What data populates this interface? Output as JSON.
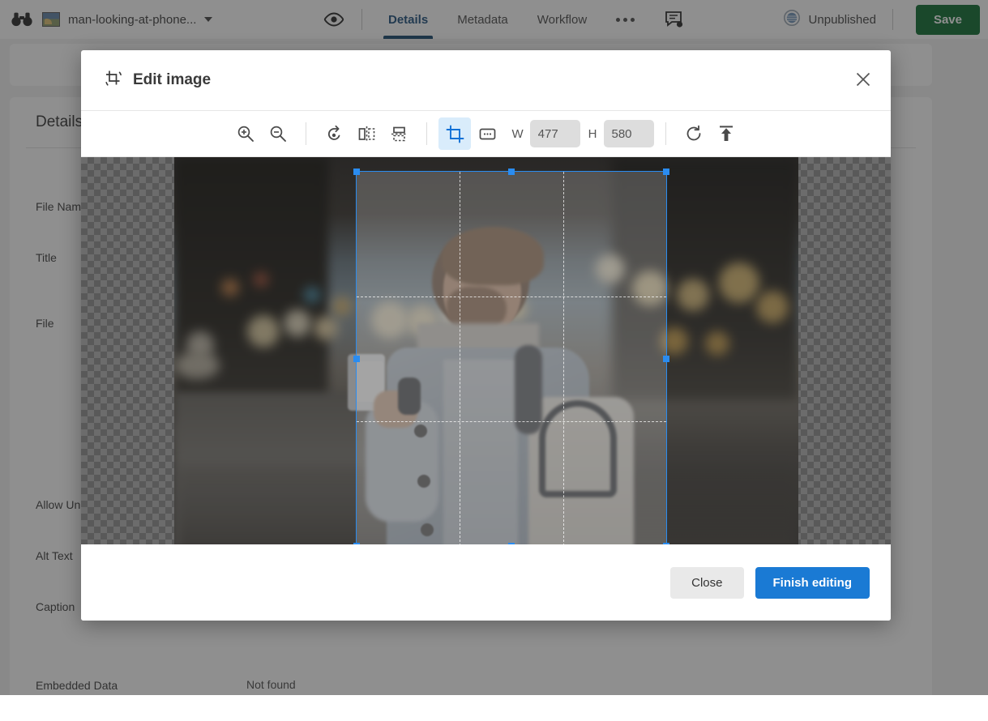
{
  "topbar": {
    "logo_icon": "binoculars-icon",
    "asset_thumb_icon": "image-thumbnail-icon",
    "asset_title": "man-looking-at-phone...",
    "dropdown_icon": "chevron-down-icon",
    "preview_icon": "eye-icon",
    "tabs": [
      {
        "label": "Details",
        "active": true
      },
      {
        "label": "Metadata",
        "active": false
      },
      {
        "label": "Workflow",
        "active": false
      }
    ],
    "overflow_icon": "ellipsis-icon",
    "comments_icon": "comment-settings-icon",
    "publish_status_icon": "globe-icon",
    "publish_status": "Unpublished",
    "save_label": "Save",
    "save_color": "#0b6b2e"
  },
  "background_panel": {
    "heading": "Details",
    "fields": [
      {
        "label": "File Name",
        "value": ""
      },
      {
        "label": "Title",
        "value": ""
      },
      {
        "label": "File",
        "value": ""
      },
      {
        "label": "Allow Unre",
        "value": ""
      },
      {
        "label": "Alt Text",
        "value": ""
      },
      {
        "label": "Caption",
        "value": ""
      },
      {
        "label": "Embedded Data",
        "value": "Not found"
      }
    ]
  },
  "modal": {
    "title": "Edit image",
    "title_icon": "crop-rotate-icon",
    "close_icon": "close-icon",
    "toolbar": {
      "tools": [
        {
          "name": "zoom-in-icon",
          "label": "Zoom in",
          "active": false
        },
        {
          "name": "zoom-out-icon",
          "label": "Zoom out",
          "active": false
        },
        {
          "name": "rotate-left-icon",
          "label": "Rotate left",
          "active": false
        },
        {
          "name": "flip-horizontal-icon",
          "label": "Flip horizontal",
          "active": false
        },
        {
          "name": "flip-vertical-icon",
          "label": "Flip vertical",
          "active": false
        },
        {
          "name": "crop-icon",
          "label": "Crop",
          "active": true
        },
        {
          "name": "resize-icon",
          "label": "Resize",
          "active": false
        }
      ],
      "width_label": "W",
      "width_value": "477",
      "height_label": "H",
      "height_value": "580",
      "reset_icon": "reset-icon",
      "apply_icon": "apply-upload-icon",
      "active_accent": "#1271d6"
    },
    "crop": {
      "selection_color": "#2a8cf0",
      "grid": "rule-of-thirds",
      "handles": 8
    },
    "footer": {
      "close_label": "Close",
      "finish_label": "Finish editing",
      "finish_color": "#1a7ad4"
    }
  }
}
